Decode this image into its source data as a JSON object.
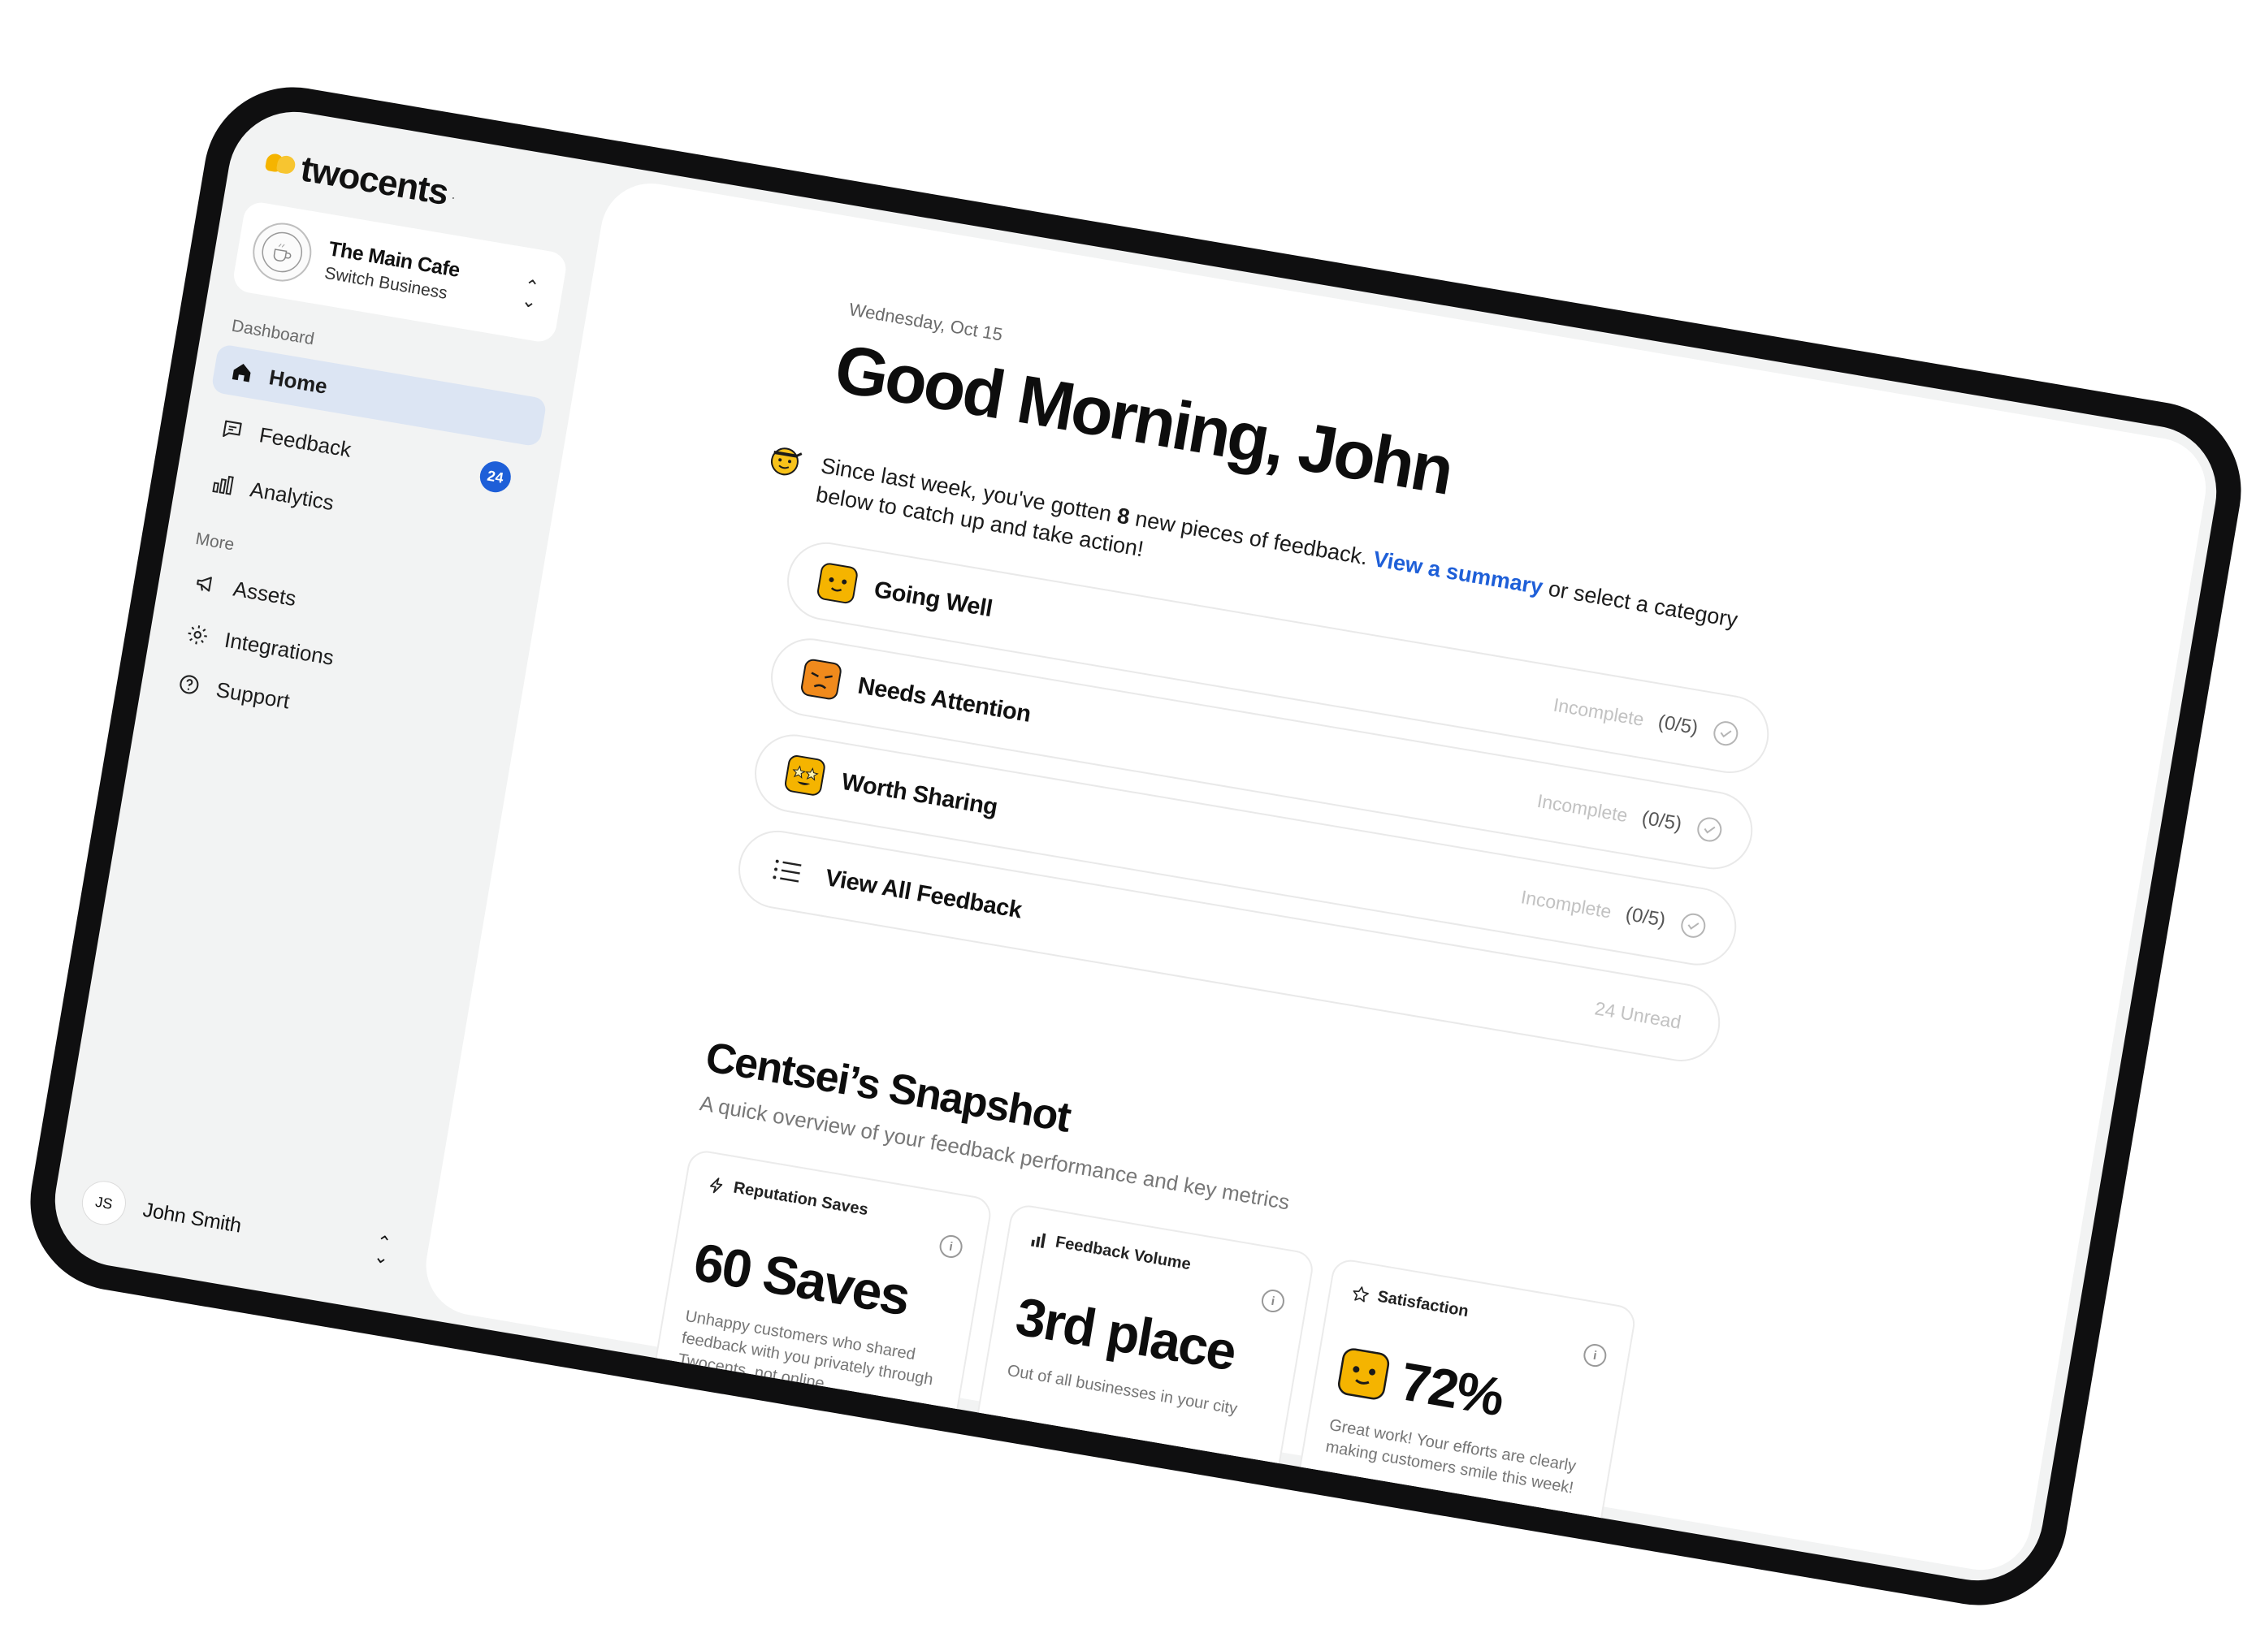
{
  "brand": {
    "name": "twocents",
    "mark": "."
  },
  "business": {
    "name": "The Main Cafe",
    "sub": "Switch Business",
    "logo_text": "THE MAIN CAFE"
  },
  "nav": {
    "dashboard_heading": "Dashboard",
    "more_heading": "More",
    "items": [
      {
        "label": "Home",
        "icon": "home-icon",
        "active": true
      },
      {
        "label": "Feedback",
        "icon": "chat-bubble-icon",
        "badge": "24"
      },
      {
        "label": "Analytics",
        "icon": "bar-chart-icon"
      },
      {
        "label": "Assets",
        "icon": "megaphone-icon"
      },
      {
        "label": "Integrations",
        "icon": "gear-icon"
      },
      {
        "label": "Support",
        "icon": "help-circle-icon"
      }
    ]
  },
  "user": {
    "initials": "JS",
    "name": "John Smith"
  },
  "main": {
    "date": "Wednesday, Oct 15",
    "greeting": "Good Morning, John",
    "intro": {
      "before": "Since last week, you've gotten ",
      "count": "8",
      "middle": " new pieces of feedback. ",
      "link": "View a summary",
      "after": " or select a category below to catch up and take action!"
    },
    "categories": [
      {
        "label": "Going Well",
        "status": "Incomplete",
        "count": "(0/5)",
        "emoji": "happy-face-icon"
      },
      {
        "label": "Needs Attention",
        "status": "Incomplete",
        "count": "(0/5)",
        "emoji": "upset-face-icon"
      },
      {
        "label": "Worth Sharing",
        "status": "Incomplete",
        "count": "(0/5)",
        "emoji": "star-eyes-face-icon"
      },
      {
        "label": "View All Feedback",
        "status": "24 Unread",
        "icon": "list-icon"
      }
    ],
    "snapshot": {
      "title": "Centsei’s Snapshot",
      "subtitle": "A quick overview of your feedback performance and key metrics",
      "cards": [
        {
          "title": "Reputation Saves",
          "icon": "lightning-icon",
          "value": "60 Saves",
          "desc": "Unhappy customers who shared feedback with you privately through Twocents, not online."
        },
        {
          "title": "Feedback Volume",
          "icon": "signal-bars-icon",
          "value": "3rd place",
          "desc": "Out of all businesses in your city"
        },
        {
          "title": "Satisfaction",
          "icon": "star-outline-icon",
          "value": "72%",
          "desc": "Great work! Your efforts are clearly making customers smile this week!"
        }
      ]
    }
  },
  "colors": {
    "accent": "#1e5fd8",
    "brand_yellow": "#f5b400",
    "active_nav": "#dce5f3",
    "device_frame": "#0f0f10"
  }
}
